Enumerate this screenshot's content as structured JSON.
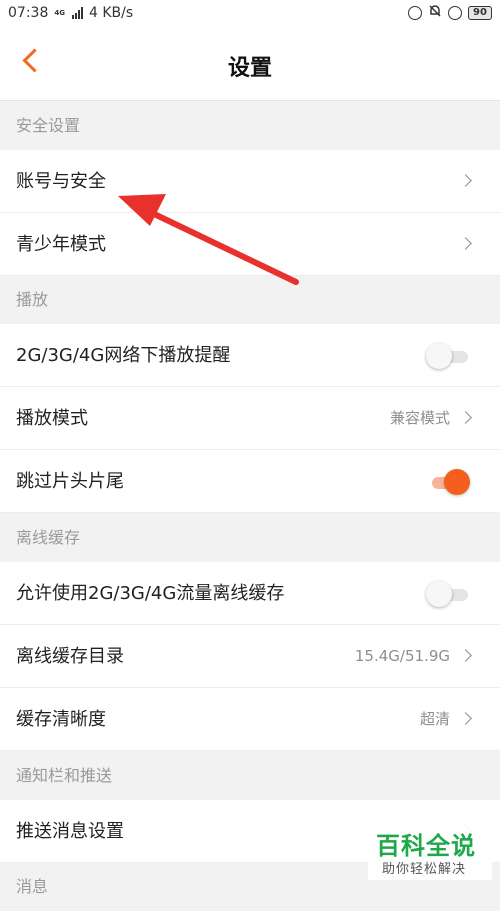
{
  "status_bar": {
    "time": "07:38",
    "network_type": "4G",
    "speed": "4 KB/s",
    "battery": "90"
  },
  "header": {
    "title": "设置"
  },
  "sections": {
    "security": "安全设置",
    "playback": "播放",
    "offline": "离线缓存",
    "notify": "通知栏和推送",
    "partial": "消息"
  },
  "rows": {
    "account": {
      "label": "账号与安全"
    },
    "youth": {
      "label": "青少年模式"
    },
    "mobile_alert": {
      "label": "2G/3G/4G网络下播放提醒",
      "toggle_on": false
    },
    "play_mode": {
      "label": "播放模式",
      "value": "兼容模式"
    },
    "skip_intro": {
      "label": "跳过片头片尾",
      "toggle_on": true
    },
    "allow_mobile_cache": {
      "label": "允许使用2G/3G/4G流量离线缓存",
      "toggle_on": false
    },
    "cache_dir": {
      "label": "离线缓存目录",
      "value": "15.4G/51.9G"
    },
    "cache_quality": {
      "label": "缓存清晰度",
      "value": "超清"
    },
    "push_settings": {
      "label": "推送消息设置"
    }
  },
  "watermark": {
    "title": "百科全说",
    "subtitle": "助你轻松解决"
  },
  "colors": {
    "accent": "#f45f1e",
    "annotation_arrow": "#e8302c",
    "watermark_green": "#1ea84a"
  }
}
